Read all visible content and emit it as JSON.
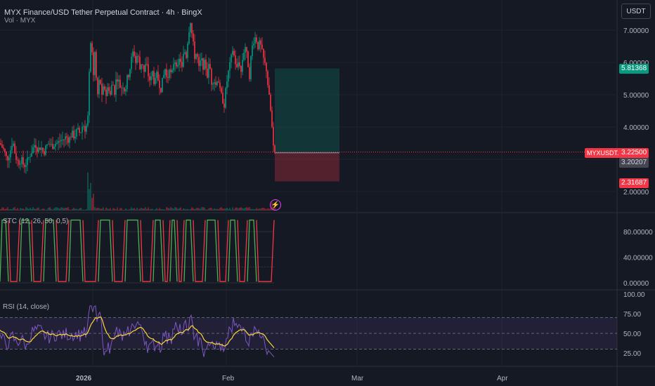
{
  "header": {
    "title": "MYX Finance/USD Tether Perpetual Contract · 4h · BingX",
    "volume_label": "Vol · MYX",
    "currency": "USDT"
  },
  "indicators": {
    "stc_label": "STC (12, 26, 50, 0,5)",
    "rsi_label": "RSI (14, close)"
  },
  "price_tags": {
    "target": "5.81368",
    "current": "3.22500",
    "entry": "3.20207",
    "stop": "2.31687",
    "symbol": "MYXUSDT.P"
  },
  "colors": {
    "up": "#089981",
    "down": "#f23645",
    "stc_up": "#4caf50",
    "stc_down": "#f23645",
    "rsi": "#7e57c2",
    "rsi_ma": "#fdd835"
  },
  "chart_data": [
    {
      "type": "candlestick",
      "yaxis": {
        "ticks": [
          "2.00000",
          "3.00000",
          "4.00000",
          "5.00000",
          "6.00000",
          "7.00000"
        ],
        "values": [
          2,
          3,
          4,
          5,
          6,
          7
        ]
      },
      "xaxis": {
        "ticks": [
          "2026",
          "Feb",
          "Mar",
          "Apr"
        ]
      },
      "close_path": [
        [
          0,
          3.5
        ],
        [
          5,
          3.3
        ],
        [
          10,
          3.0
        ],
        [
          14,
          3.2
        ],
        [
          18,
          3.6
        ],
        [
          22,
          3.1
        ],
        [
          26,
          2.9
        ],
        [
          30,
          3.0
        ],
        [
          34,
          2.8
        ],
        [
          38,
          2.9
        ],
        [
          42,
          3.1
        ],
        [
          46,
          3.3
        ],
        [
          50,
          3.5
        ],
        [
          54,
          3.3
        ],
        [
          58,
          3.4
        ],
        [
          62,
          3.2
        ],
        [
          66,
          3.4
        ],
        [
          70,
          3.5
        ],
        [
          74,
          3.4
        ],
        [
          78,
          3.5
        ],
        [
          82,
          3.5
        ],
        [
          86,
          3.6
        ],
        [
          90,
          3.6
        ],
        [
          94,
          3.7
        ],
        [
          98,
          3.6
        ],
        [
          102,
          3.8
        ],
        [
          106,
          3.7
        ],
        [
          110,
          3.9
        ],
        [
          114,
          3.8
        ],
        [
          118,
          4.1
        ],
        [
          122,
          3.9
        ],
        [
          125,
          4.3
        ],
        [
          127,
          5.6
        ],
        [
          129,
          6.7
        ],
        [
          131,
          6.2
        ],
        [
          133,
          5.5
        ],
        [
          135,
          6.3
        ],
        [
          137,
          5.5
        ],
        [
          139,
          5.0
        ],
        [
          142,
          5.6
        ],
        [
          145,
          4.9
        ],
        [
          148,
          5.3
        ],
        [
          151,
          5.0
        ],
        [
          154,
          5.3
        ],
        [
          157,
          5.0
        ],
        [
          160,
          5.4
        ],
        [
          163,
          5.1
        ],
        [
          166,
          5.6
        ],
        [
          169,
          5.4
        ],
        [
          172,
          5.2
        ],
        [
          175,
          5.3
        ],
        [
          178,
          5.1
        ],
        [
          181,
          5.5
        ],
        [
          184,
          5.7
        ],
        [
          187,
          6.1
        ],
        [
          190,
          6.4
        ],
        [
          193,
          6.0
        ],
        [
          196,
          6.3
        ],
        [
          199,
          5.8
        ],
        [
          202,
          6.1
        ],
        [
          205,
          5.7
        ],
        [
          208,
          6.0
        ],
        [
          211,
          5.6
        ],
        [
          214,
          5.4
        ],
        [
          217,
          5.7
        ],
        [
          220,
          5.3
        ],
        [
          223,
          5.6
        ],
        [
          226,
          5.4
        ],
        [
          229,
          5.2
        ],
        [
          232,
          5.5
        ],
        [
          235,
          5.8
        ],
        [
          238,
          5.4
        ],
        [
          241,
          5.9
        ],
        [
          244,
          5.5
        ],
        [
          247,
          6.0
        ],
        [
          250,
          6.1
        ],
        [
          253,
          5.8
        ],
        [
          256,
          6.2
        ],
        [
          259,
          5.8
        ],
        [
          262,
          6.4
        ],
        [
          265,
          6.2
        ],
        [
          268,
          6.9
        ],
        [
          271,
          7.3
        ],
        [
          274,
          6.7
        ],
        [
          277,
          6.2
        ],
        [
          280,
          6.3
        ],
        [
          283,
          5.8
        ],
        [
          286,
          6.1
        ],
        [
          289,
          5.9
        ],
        [
          292,
          6.0
        ],
        [
          295,
          5.6
        ],
        [
          298,
          6.0
        ],
        [
          301,
          5.4
        ],
        [
          304,
          5.5
        ],
        [
          307,
          5.3
        ],
        [
          310,
          5.6
        ],
        [
          313,
          5.1
        ],
        [
          316,
          4.9
        ],
        [
          319,
          4.7
        ],
        [
          322,
          5.3
        ],
        [
          325,
          5.7
        ],
        [
          328,
          6.0
        ],
        [
          331,
          6.4
        ],
        [
          334,
          6.1
        ],
        [
          337,
          5.8
        ],
        [
          340,
          6.1
        ],
        [
          343,
          5.7
        ],
        [
          346,
          6.3
        ],
        [
          349,
          6.5
        ],
        [
          352,
          6.1
        ],
        [
          355,
          5.6
        ],
        [
          358,
          6.4
        ],
        [
          361,
          6.7
        ],
        [
          364,
          6.8
        ],
        [
          367,
          6.5
        ],
        [
          370,
          6.6
        ],
        [
          373,
          6.3
        ],
        [
          376,
          6.0
        ],
        [
          379,
          5.8
        ],
        [
          382,
          5.1
        ],
        [
          385,
          4.5
        ],
        [
          388,
          3.7
        ],
        [
          391,
          3.2
        ]
      ]
    },
    {
      "type": "rectangle-annotation",
      "entry": 3.20207,
      "target": 5.81368,
      "stop": 2.31687
    },
    {
      "type": "line",
      "title": "STC (12, 26, 50, 0,5)",
      "yaxis": {
        "ticks": [
          "0.00000",
          "40.00000",
          "80.00000"
        ],
        "values": [
          0,
          40,
          80
        ]
      }
    },
    {
      "type": "line",
      "title": "RSI (14, close)",
      "yaxis": {
        "ticks": [
          "25.00",
          "50.00",
          "75.00",
          "100.00"
        ],
        "values": [
          25,
          50,
          75,
          100
        ]
      }
    }
  ]
}
